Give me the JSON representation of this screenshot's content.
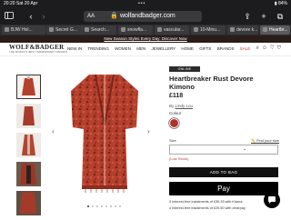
{
  "status_bar": {
    "time": "20:20",
    "date": "Sat 20 Apr",
    "battery": "84%"
  },
  "safari": {
    "url": "wolfandbadger.com",
    "reader": "AA"
  },
  "tabs": [
    {
      "label": "BJW Hol..."
    },
    {
      "label": "Secret G..."
    },
    {
      "label": "Search..."
    },
    {
      "label": "snowfla..."
    },
    {
      "label": "vascular..."
    },
    {
      "label": "10-Minu..."
    },
    {
      "label": "devore k..."
    },
    {
      "label": "Heartbr..."
    }
  ],
  "promo_banner": "New Season Styles Every Day: Discover Now",
  "header": {
    "logo": "WOLF&BADGER",
    "tagline": "THE WORLD'S BEST INDEPENDENT BRANDS",
    "nav": [
      "NEW IN",
      "TRENDING",
      "WOMEN",
      "MEN",
      "JEWELLERY",
      "HOME",
      "GIFTS",
      "BRANDS",
      "SALE"
    ]
  },
  "gallery": {
    "current_image": 1,
    "image_count": 8
  },
  "product": {
    "badge": "ONLINE EXCLUSIVE",
    "title": "Heartbreaker Rust Devore Kimono",
    "price": "£118",
    "brand_prefix": "By",
    "brand": "Lindy Lou",
    "colour_label": "Colour",
    "size_label": "Size",
    "find_size": "Find your size",
    "size_select": "",
    "stock": "(Low Stock)",
    "add_to_bag": "ADD TO BAG",
    "apple_pay": "Pay",
    "klarna": "3 interest-free instalments of £39.33 with Klarna.",
    "clearpay": "4 interest-free instalments of £29.50 with clearpay"
  },
  "colors": {
    "accent_sale": "#c0392b",
    "swatch": "#b0322a",
    "product_fabric": "#b5402d"
  }
}
